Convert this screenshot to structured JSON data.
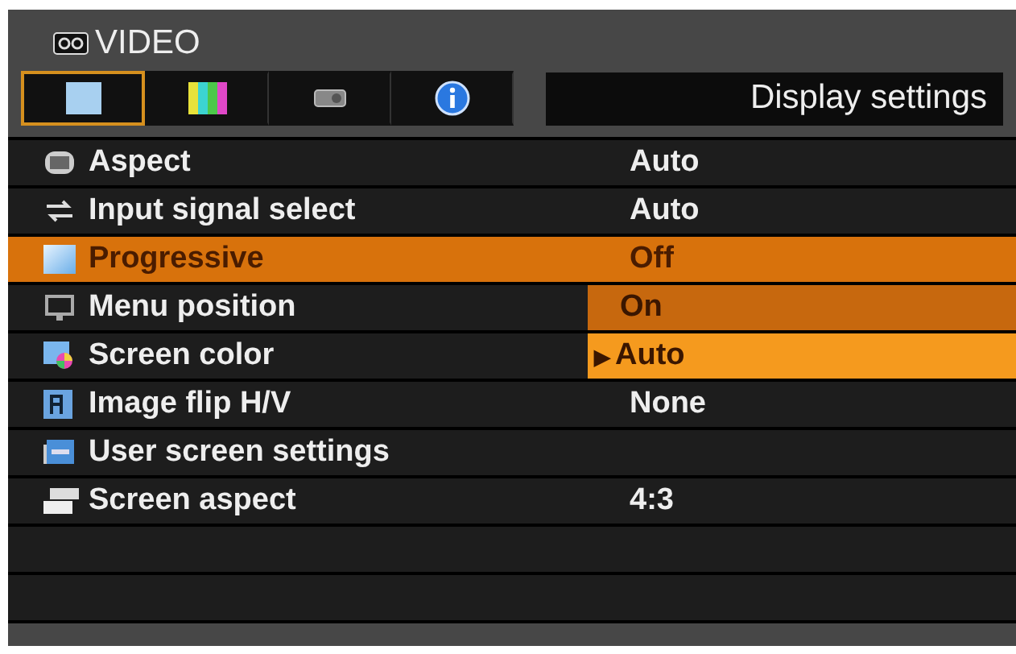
{
  "header": {
    "title": "VIDEO"
  },
  "tabs": [
    {
      "selected": true
    },
    {
      "selected": false
    },
    {
      "selected": false
    },
    {
      "selected": false
    }
  ],
  "section_title": "Display settings",
  "items": [
    {
      "label": "Aspect",
      "value": "Auto",
      "selected": false
    },
    {
      "label": "Input signal select",
      "value": "Auto",
      "selected": false
    },
    {
      "label": "Progressive",
      "value": "Off",
      "selected": true
    },
    {
      "label": "Menu position",
      "selected": false
    },
    {
      "label": "Screen color",
      "selected": false
    },
    {
      "label": "Image flip H/V",
      "value": "None",
      "selected": false
    },
    {
      "label": "User screen settings",
      "selected": false
    },
    {
      "label": "Screen aspect",
      "value": "4:3",
      "selected": false
    }
  ],
  "dropdown": {
    "pointer": "▶",
    "options": [
      {
        "label": "On",
        "selected": false
      },
      {
        "label": "Auto",
        "selected": true
      }
    ]
  }
}
